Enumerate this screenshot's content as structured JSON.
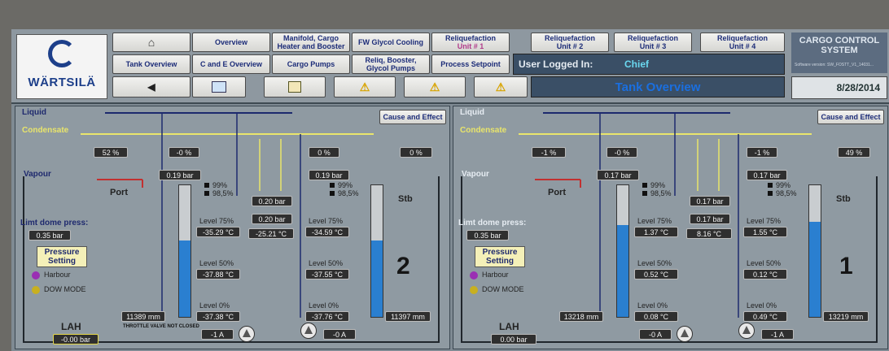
{
  "header": {
    "logo_text": "WÄRTSILÄ",
    "nav_row1": [
      "⌂",
      "Overview",
      "Manifold, Cargo Heater and Booster",
      "FW Glycol Cooling",
      "Reliquefaction",
      "Reliquefaction",
      "Reliquefaction",
      "Reliquefaction"
    ],
    "nav_row1_sub": [
      "Unit # 1",
      "Unit # 2",
      "Unit # 3",
      "Unit # 4"
    ],
    "nav_row2": [
      "Tank Overview",
      "C and E Overview",
      "Cargo Pumps",
      "Reliq, Booster, Glycol Pumps",
      "Process Setpoint"
    ],
    "user_label": "User Logged In:",
    "user_name": "Chief",
    "page_title": "Tank Overview",
    "banner_title": "CARGO CONTROL SYSTEM",
    "banner_version": "Software version: SW_FOSTT_V1_14031...",
    "date": "8/28/2014",
    "icons": [
      "back-arrow-icon",
      "trend-icon",
      "report-icon",
      "alarm-icon",
      "alarm-icon",
      "alarm-icon"
    ]
  },
  "panels": [
    {
      "tank_number": "2",
      "cause_effect": "Cause and Effect",
      "liquid": "Liquid",
      "condensate": "Condensate",
      "vapour": "Vapour",
      "port": "Port",
      "stb": "Stb",
      "limit_label": "Limt dome press:",
      "limit_value": "0.35 bar",
      "pressure_setting": "Pressure Setting",
      "harbour": "Harbour",
      "dow_mode": "DOW MODE",
      "lah": "LAH",
      "lah_value": "-0.00 bar",
      "valve_pcts": [
        "52 %",
        "-0 %",
        "0 %",
        "0 %"
      ],
      "pressures": [
        "0.19 bar",
        "0.19 bar",
        "0.20 bar"
      ],
      "legend": [
        "99%",
        "98,5%",
        "99%",
        "98,5%"
      ],
      "mid_pressure": "0.20 bar",
      "mid_temp": "-25.21 °C",
      "levels": [
        "Level 75%",
        "Level 50%",
        "Level 0%"
      ],
      "left_temps": [
        "-35.29 °C",
        "-37.88 °C",
        "-37.38 °C"
      ],
      "right_temps": [
        "-34.59 °C",
        "-37.55 °C",
        "-37.76 °C"
      ],
      "left_mm": "11389 mm",
      "right_mm": "11397 mm",
      "pump_amps": [
        "-1 A",
        "-0 A"
      ],
      "note": "THROTTLE VALVE NOT CLOSED",
      "left_fill": 0.58,
      "right_fill": 0.58
    },
    {
      "tank_number": "1",
      "cause_effect": "Cause and Effect",
      "liquid": "Liquid",
      "condensate": "Condensate",
      "vapour": "Vapour",
      "port": "Port",
      "stb": "Stb",
      "limit_label": "Limt dome press:",
      "limit_value": "0.35 bar",
      "pressure_setting": "Pressure Setting",
      "harbour": "Harbour",
      "dow_mode": "DOW MODE",
      "lah": "LAH",
      "lah_value": "0.00 bar",
      "valve_pcts": [
        "-1 %",
        "-0 %",
        "-1 %",
        "49 %"
      ],
      "pressures": [
        "0.17 bar",
        "0.17 bar",
        "0.17 bar"
      ],
      "legend": [
        "99%",
        "98,5%",
        "99%",
        "98,5%"
      ],
      "mid_pressure": "0.17 bar",
      "mid_temp": "8.16 °C",
      "levels": [
        "Level 75%",
        "Level 50%",
        "Level 0%"
      ],
      "left_temps": [
        "1.37 °C",
        "0.52 °C",
        "0.08 °C"
      ],
      "right_temps": [
        "1.55 °C",
        "0.12 °C",
        "0.49 °C"
      ],
      "left_mm": "13218 mm",
      "right_mm": "13219 mm",
      "pump_amps": [
        "-0 A",
        "-1 A"
      ],
      "left_fill": 0.7,
      "right_fill": 0.72
    }
  ]
}
